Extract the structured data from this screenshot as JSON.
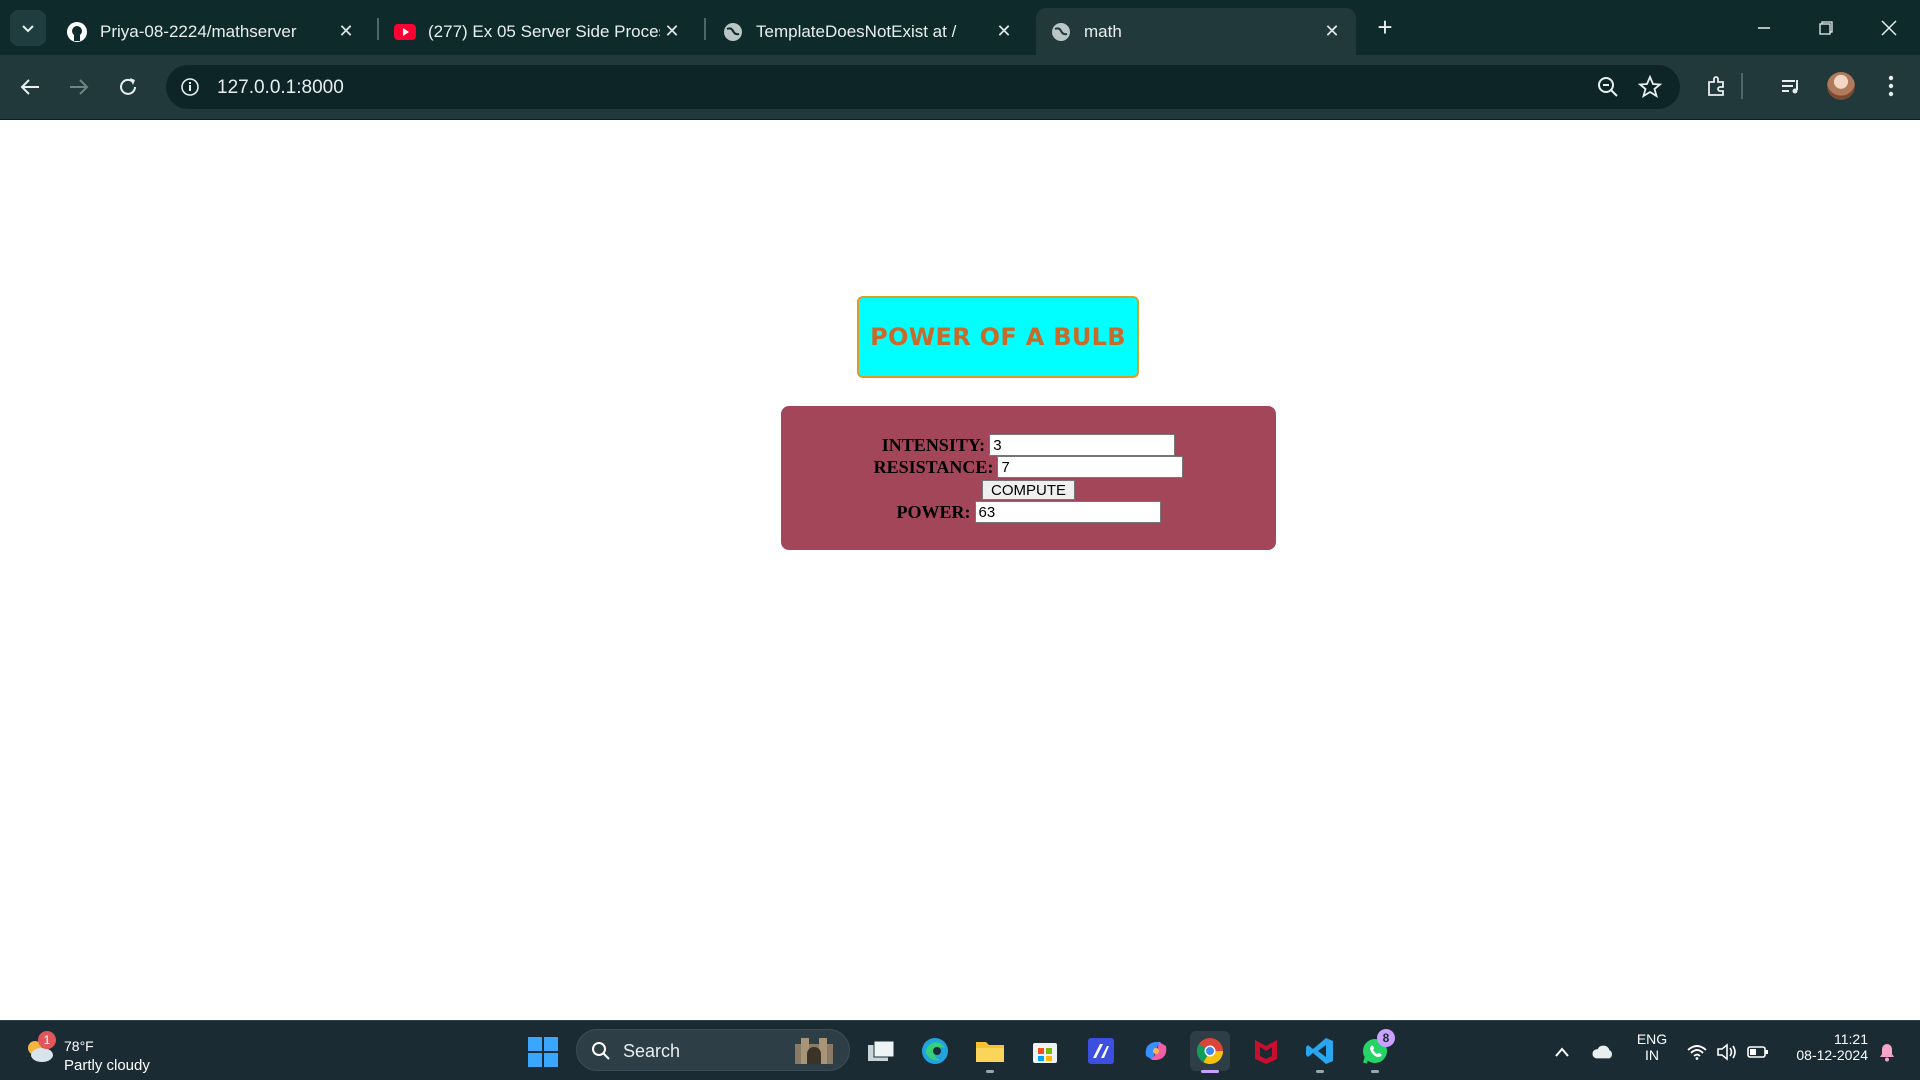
{
  "browser": {
    "tabs": [
      {
        "title": "Priya-08-2224/mathserver",
        "icon": "github-icon"
      },
      {
        "title": "(277) Ex 05 Server Side Processi",
        "icon": "youtube-icon"
      },
      {
        "title": "TemplateDoesNotExist at /",
        "icon": "globe-icon"
      },
      {
        "title": "math",
        "icon": "globe-icon",
        "active": true
      }
    ],
    "url": "127.0.0.1:8000"
  },
  "page": {
    "heading": "POWER OF A BULB",
    "form": {
      "intensity_label": "INTENSITY:",
      "intensity_value": "3",
      "resistance_label": "RESISTANCE:",
      "resistance_value": "7",
      "compute_label": "COMPUTE",
      "power_label": "POWER:",
      "power_value": "63"
    },
    "colors": {
      "heading_bg": "#00ffff",
      "heading_text": "#c86b2a",
      "form_bg": "#a34659"
    }
  },
  "taskbar": {
    "weather": {
      "temp": "78°F",
      "condition": "Partly cloudy",
      "badge": "1"
    },
    "search_label": "Search",
    "whatsapp_badge": "8",
    "language": {
      "line1": "ENG",
      "line2": "IN"
    },
    "clock": {
      "time": "11:21",
      "date": "08-12-2024"
    }
  }
}
